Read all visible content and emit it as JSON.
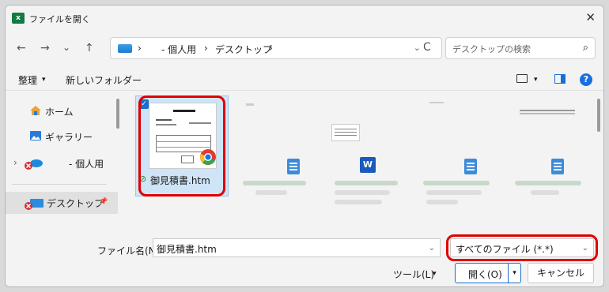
{
  "window": {
    "title": "ファイルを開く",
    "app_icon_letter": "x",
    "close": "✕"
  },
  "nav": {
    "back": "←",
    "forward": "→",
    "recent": "⌄",
    "up": "↑",
    "crumb_sep1": "›",
    "crumb_folder": "- 個人用",
    "crumb_sep2": "›",
    "crumb_current": "デスクトップ",
    "crumb_sep3": "›",
    "addr_dropdown": "⌄",
    "refresh": "C",
    "search_placeholder": "デスクトップの検索",
    "search_icon": "⌕"
  },
  "toolbar": {
    "organize": "整理",
    "organize_caret": "▾",
    "new_folder": "新しいフォルダー",
    "view_caret": "▾",
    "help": "?"
  },
  "sidebar": {
    "items": [
      {
        "label": "ホーム",
        "icon": "home-icon"
      },
      {
        "label": "ギャラリー",
        "icon": "gallery-icon"
      },
      {
        "label": "- 個人用",
        "icon": "onedrive-icon",
        "chevron": "›"
      },
      {
        "label": "デスクトップ",
        "icon": "desktop-icon",
        "pin": "📌"
      }
    ]
  },
  "files": {
    "selected_name": "御見積書.htm",
    "selected_check": "✓"
  },
  "bottom": {
    "filename_label": "ファイル名(N):",
    "filename_value": "御見積書.htm",
    "filename_dropdown": "⌄",
    "filetype_value": "すべてのファイル (*.*)",
    "filetype_dropdown": "⌄",
    "tools_label": "ツール(L)",
    "tools_caret": "▾",
    "open_label": "開く(O)",
    "open_caret": "▾",
    "cancel_label": "キャンセル"
  },
  "colors": {
    "highlight_outline": "#e00000",
    "selection_bg": "#cfe4f7",
    "accent": "#1a6fd0"
  }
}
